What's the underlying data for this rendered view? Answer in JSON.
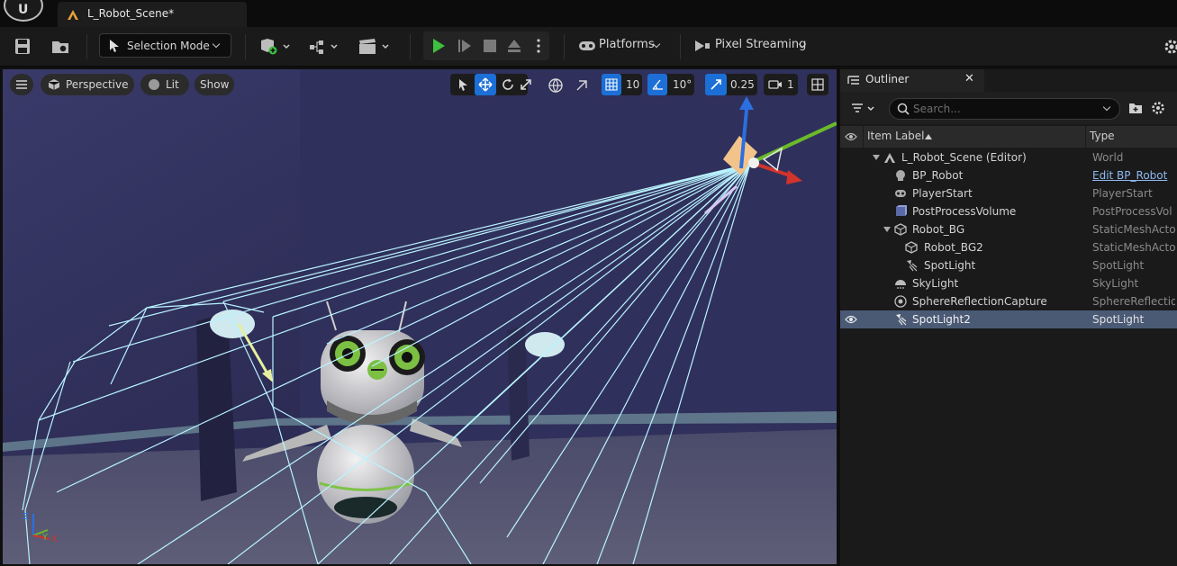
{
  "title_bar": {
    "level_tab_label": "L_Robot_Scene*"
  },
  "toolbar": {
    "selection_mode_label": "Selection Mode",
    "platforms_label": "Platforms",
    "pixel_streaming_label": "Pixel Streaming"
  },
  "viewport": {
    "perspective_label": "Perspective",
    "lit_label": "Lit",
    "show_label": "Show",
    "grid_snap_value": "10",
    "rotation_snap_value": "10°",
    "scale_snap_value": "0.25",
    "camera_speed_value": "1",
    "axis_labels": {
      "z": "Z",
      "y": "Y",
      "x": "X"
    }
  },
  "outliner": {
    "tab_title": "Outliner",
    "search_placeholder": "Search...",
    "columns": {
      "item_label": "Item Label",
      "type": "Type"
    },
    "rows": [
      {
        "label": "L_Robot_Scene (Editor)",
        "type": "World",
        "icon": "world-icon"
      },
      {
        "label": "BP_Robot",
        "type": "Edit BP_Robot",
        "icon": "blueprint-icon"
      },
      {
        "label": "PlayerStart",
        "type": "PlayerStart",
        "icon": "player-start-icon"
      },
      {
        "label": "PostProcessVolume",
        "type": "PostProcessVol",
        "icon": "volume-icon"
      },
      {
        "label": "Robot_BG",
        "type": "StaticMeshActo",
        "icon": "static-mesh-icon"
      },
      {
        "label": "Robot_BG2",
        "type": "StaticMeshActo",
        "icon": "static-mesh-icon"
      },
      {
        "label": "SpotLight",
        "type": "SpotLight",
        "icon": "spotlight-icon"
      },
      {
        "label": "SkyLight",
        "type": "SkyLight",
        "icon": "skylight-icon"
      },
      {
        "label": "SphereReflectionCapture",
        "type": "SphereReflectio",
        "icon": "reflection-capture-icon"
      },
      {
        "label": "SpotLight2",
        "type": "SpotLight",
        "icon": "spotlight-icon",
        "selected": true
      }
    ]
  },
  "colors": {
    "accent_blue": "#1c6fd6",
    "play_green": "#3fbf3f",
    "selection_row": "#4a5a75",
    "spotlight_cone": "#b9f3ff"
  }
}
